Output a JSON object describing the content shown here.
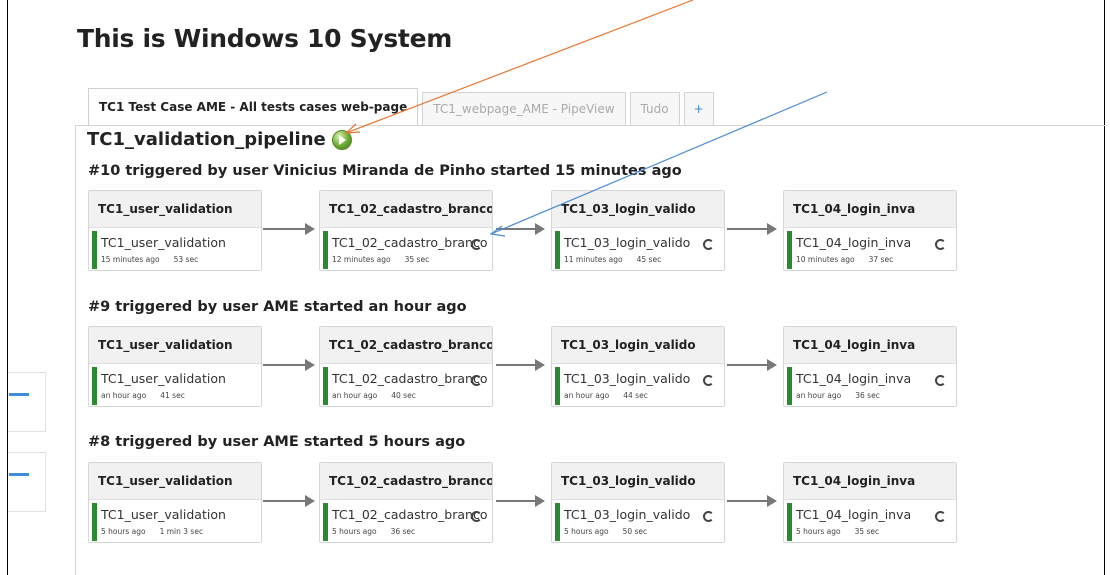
{
  "page_title": "This is Windows 10 System",
  "tabs": [
    {
      "label": "TC1 Test Case AME - All tests cases web-page",
      "active": true
    },
    {
      "label": "TC1_webpage_AME - PipeView",
      "active": false
    },
    {
      "label": "Tudo",
      "active": false
    },
    {
      "label": "+",
      "active": false
    }
  ],
  "pipeline": {
    "name": "TC1_validation_pipeline",
    "run_icon": "play-circle-icon",
    "runs": [
      {
        "heading": "#10 triggered by user Vinicius Miranda de Pinho started 15 minutes ago",
        "stages": [
          {
            "title": "TC1_user_validation",
            "job": "TC1_user_validation",
            "when": "15 minutes ago",
            "duration": "53 sec",
            "rerun": false
          },
          {
            "title": "TC1_02_cadastro_branco",
            "job": "TC1_02_cadastro_branco",
            "when": "12 minutes ago",
            "duration": "35 sec",
            "rerun": true
          },
          {
            "title": "TC1_03_login_valido",
            "job": "TC1_03_login_valido",
            "when": "11 minutes ago",
            "duration": "45 sec",
            "rerun": true
          },
          {
            "title": "TC1_04_login_inva",
            "job": "TC1_04_login_inva",
            "when": "10 minutes ago",
            "duration": "37 sec",
            "rerun": true
          }
        ]
      },
      {
        "heading": "#9 triggered by user AME started an hour ago",
        "stages": [
          {
            "title": "TC1_user_validation",
            "job": "TC1_user_validation",
            "when": "an hour ago",
            "duration": "41 sec",
            "rerun": false
          },
          {
            "title": "TC1_02_cadastro_branco",
            "job": "TC1_02_cadastro_branco",
            "when": "an hour ago",
            "duration": "40 sec",
            "rerun": true
          },
          {
            "title": "TC1_03_login_valido",
            "job": "TC1_03_login_valido",
            "when": "an hour ago",
            "duration": "44 sec",
            "rerun": true
          },
          {
            "title": "TC1_04_login_inva",
            "job": "TC1_04_login_inva",
            "when": "an hour ago",
            "duration": "36 sec",
            "rerun": true
          }
        ]
      },
      {
        "heading": "#8 triggered by user AME started 5 hours ago",
        "stages": [
          {
            "title": "TC1_user_validation",
            "job": "TC1_user_validation",
            "when": "5 hours ago",
            "duration": "1 min 3 sec",
            "rerun": false
          },
          {
            "title": "TC1_02_cadastro_branco",
            "job": "TC1_02_cadastro_branco",
            "when": "5 hours ago",
            "duration": "36 sec",
            "rerun": true
          },
          {
            "title": "TC1_03_login_valido",
            "job": "TC1_03_login_valido",
            "when": "5 hours ago",
            "duration": "50 sec",
            "rerun": true
          },
          {
            "title": "TC1_04_login_inva",
            "job": "TC1_04_login_inva",
            "when": "5 hours ago",
            "duration": "35 sec",
            "rerun": true
          }
        ]
      }
    ]
  },
  "colors": {
    "success_bar": "#2a8a2e",
    "tab_add": "#3a8fd8",
    "annotation_orange": "#e8742c",
    "annotation_blue": "#4a8ad4"
  }
}
